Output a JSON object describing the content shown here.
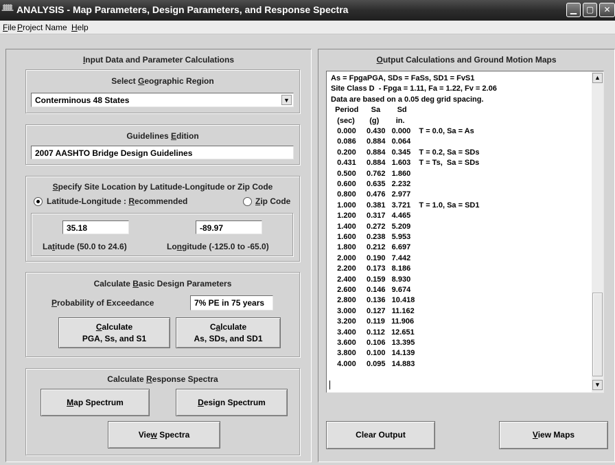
{
  "window": {
    "app_glyph": "ᚙ",
    "title": "ANALYSIS - Map Parameters, Design Parameters, and Response Spectra",
    "min_label": "▁",
    "max_label": "▢",
    "close_label": "✕"
  },
  "menu": [
    {
      "accel": "F",
      "rest": "ile"
    },
    {
      "accel": "P",
      "rest": "roject Name"
    },
    {
      "accel": "H",
      "rest": "elp"
    }
  ],
  "left_panel": {
    "heading_accel": "I",
    "heading_rest": "nput Data and Parameter Calculations",
    "region": {
      "heading_pre": "Select ",
      "heading_accel": "G",
      "heading_rest": "eographic Region",
      "value": "Conterminous 48 States",
      "dropdown_arrow": "▼"
    },
    "guidelines": {
      "heading_pre": "Guidelines ",
      "heading_accel": "E",
      "heading_rest": "dition",
      "value": "2007 AASHTO Bridge Design Guidelines"
    },
    "site": {
      "heading_accel": "S",
      "heading_rest": "pecify Site Location by Latitude-Longitude or Zip Code",
      "radio_latlon_pre": "Latitude-Longitude  : ",
      "radio_latlon_accel": "R",
      "radio_latlon_rest": "ecommended",
      "radio_zip_accel": "Z",
      "radio_zip_rest": "ip Code",
      "latitude_value": "35.18",
      "longitude_value": "-89.97",
      "latitude_label_pre": "La",
      "latitude_label_accel": "t",
      "latitude_label_rest": "itude (50.0 to 24.6)",
      "longitude_label_pre": "Lo",
      "longitude_label_accel": "n",
      "longitude_label_rest": "gitude (-125.0 to -65.0)"
    },
    "basic": {
      "heading_pre": "Calculate ",
      "heading_accel": "B",
      "heading_rest": "asic Design Parameters",
      "pe_label_accel": "P",
      "pe_label_rest": "robability of Exceedance",
      "pe_value": "7% PE in 75 years",
      "btn1_line1_accel": "C",
      "btn1_line1_rest": "alculate",
      "btn1_line2": "PGA, Ss, and S1",
      "btn2_line1_pre": "C",
      "btn2_line1_accel": "a",
      "btn2_line1_rest": "lculate",
      "btn2_line2": "As, SDs, and SD1"
    },
    "response": {
      "heading_pre": "Calculate ",
      "heading_accel": "R",
      "heading_rest": "esponse Spectra",
      "map_btn_accel": "M",
      "map_btn_rest": "ap Spectrum",
      "design_btn_accel": "D",
      "design_btn_rest": "esign Spectrum",
      "view_btn_pre": "Vie",
      "view_btn_accel": "w",
      "view_btn_rest": " Spectra"
    }
  },
  "right_panel": {
    "heading_accel": "O",
    "heading_rest": "utput Calculations and Ground Motion Maps",
    "output_lines": [
      "As = FpgaPGA, SDs = FaSs, SD1 = FvS1",
      "Site Class D  - Fpga = 1.11, Fa = 1.22, Fv = 2.06",
      "Data are based on a 0.05 deg grid spacing.",
      "  Period      Sa        Sd",
      "   (sec)       (g)        in.",
      "   0.000     0.430   0.000    T = 0.0, Sa = As",
      "   0.086     0.884   0.064",
      "   0.200     0.884   0.345    T = 0.2, Sa = SDs",
      "   0.431     0.884   1.603    T = Ts,  Sa = SDs",
      "   0.500     0.762   1.860",
      "   0.600     0.635   2.232",
      "   0.800     0.476   2.977",
      "   1.000     0.381   3.721    T = 1.0, Sa = SD1",
      "   1.200     0.317   4.465",
      "   1.400     0.272   5.209",
      "   1.600     0.238   5.953",
      "   1.800     0.212   6.697",
      "   2.000     0.190   7.442",
      "   2.200     0.173   8.186",
      "   2.400     0.159   8.930",
      "   2.600     0.146   9.674",
      "   2.800     0.136   10.418",
      "   3.000     0.127   11.162",
      "   3.200     0.119   11.906",
      "   3.400     0.112   12.651",
      "   3.600     0.106   13.395",
      "   3.800     0.100   14.139",
      "   4.000     0.095   14.883"
    ],
    "scroll_up": "▲",
    "scroll_down": "▼",
    "clear_btn": "Clear Output",
    "maps_btn_accel": "V",
    "maps_btn_rest": "iew Maps"
  }
}
